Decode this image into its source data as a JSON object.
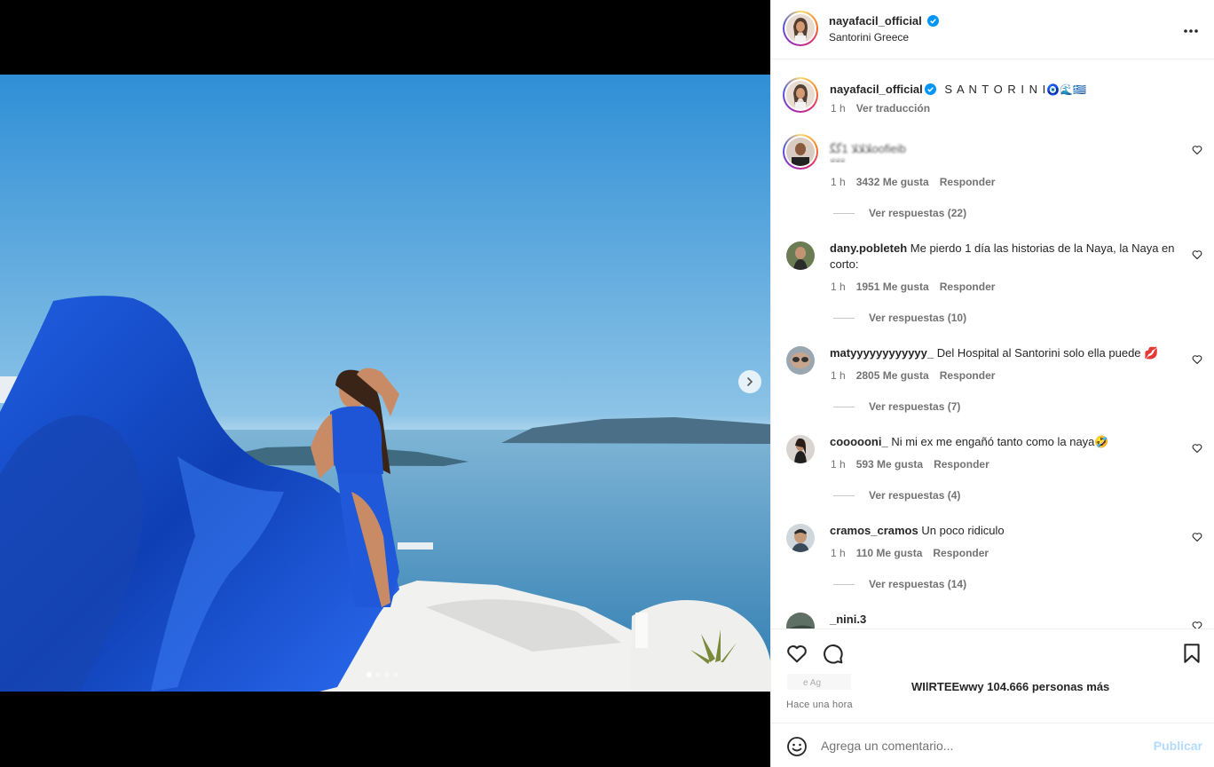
{
  "post": {
    "username": "nayafacil_official",
    "location": "Santorini Greece",
    "caption": "S A N T O R I N I",
    "caption_emojis": "🧿🌊🇬🇷",
    "caption_time": "1 h",
    "translate_label": "Ver traducción",
    "carousel_total": 4,
    "carousel_index": 1
  },
  "comments": [
    {
      "username": "",
      "text": "ﻼﻼﻼ 1ﮔﮕoofieib",
      "text_tail": "ﻻﻻﻻ",
      "time": "1 h",
      "likes": "3432 Me gusta",
      "reply_label": "Responder",
      "view_replies": "Ver respuestas (22)"
    },
    {
      "username": "dany.pobleteh",
      "text": "Me pierdo 1 día las historias de la Naya, la Naya en corto:",
      "time": "1 h",
      "likes": "1951 Me gusta",
      "reply_label": "Responder",
      "view_replies": "Ver respuestas (10)"
    },
    {
      "username": "matyyyyyyyyyyyy_",
      "text": "Del Hospital al Santorini solo ella puede 💋",
      "time": "1 h",
      "likes": "2805 Me gusta",
      "reply_label": "Responder",
      "view_replies": "Ver respuestas (7)"
    },
    {
      "username": "coooooni_",
      "text": "Ni mi ex me engañó tanto como la naya🤣",
      "time": "1 h",
      "likes": "593 Me gusta",
      "reply_label": "Responder",
      "view_replies": "Ver respuestas (4)"
    },
    {
      "username": "cramos_cramos",
      "text": "Un poco ridiculo",
      "time": "1 h",
      "likes": "110 Me gusta",
      "reply_label": "Responder",
      "view_replies": "Ver respuestas (14)"
    },
    {
      "username": "_nini.3",
      "text": ""
    }
  ],
  "likes_line": {
    "names": "WIlRTEEwwy",
    "others": "104.666 personas más"
  },
  "time_ago": "Hace una hora",
  "composer": {
    "placeholder": "Agrega un comentario...",
    "publish_label": "Publicar"
  },
  "colors": {
    "sky_top": "#2f8fd6",
    "sky_bottom": "#d9ecf5",
    "sea": "#3a86b8",
    "dress": "#1a52c9",
    "publish_disabled": "#b3dbff",
    "verified": "#0095f6"
  },
  "icons": [
    "more-options-icon",
    "verified-badge-icon",
    "chevron-right-icon",
    "heart-icon",
    "comment-icon",
    "bookmark-icon",
    "emoji-icon"
  ]
}
